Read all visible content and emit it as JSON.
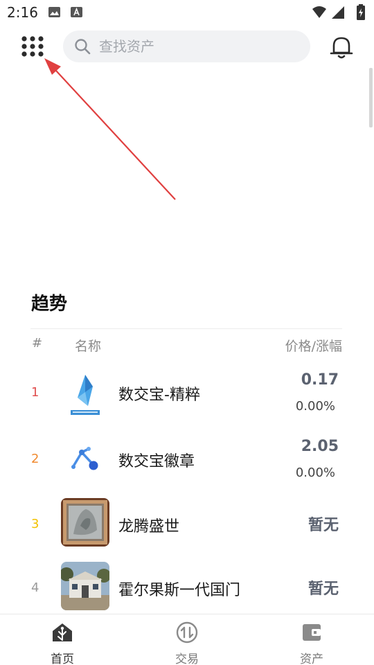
{
  "status_bar": {
    "time": "2:16"
  },
  "header": {
    "search_placeholder": "查找资产",
    "grid_icon": "grid-icon",
    "bell_icon": "bell-icon"
  },
  "trend": {
    "title": "趋势",
    "columns": {
      "rank": "#",
      "name": "名称",
      "price": "价格/涨幅"
    },
    "rows": [
      {
        "rank": "1",
        "name": "数交宝-精粹",
        "price": "0.17",
        "change": "0.00%",
        "rank_color": "#e05050"
      },
      {
        "rank": "2",
        "name": "数交宝徽章",
        "price": "2.05",
        "change": "0.00%",
        "rank_color": "#f08a30"
      },
      {
        "rank": "3",
        "name": "龙腾盛世",
        "price": "暂无",
        "rank_color": "#f2c200"
      },
      {
        "rank": "4",
        "name": "霍尔果斯一代国门",
        "price": "暂无",
        "rank_color": "#9a9a9a"
      }
    ]
  },
  "bottom_nav": {
    "items": [
      {
        "label": "首页",
        "icon": "home-icon"
      },
      {
        "label": "交易",
        "icon": "exchange-icon"
      },
      {
        "label": "资产",
        "icon": "wallet-icon"
      }
    ]
  },
  "colors": {
    "annotation_arrow": "#e04040",
    "price_text": "#5b6270"
  }
}
